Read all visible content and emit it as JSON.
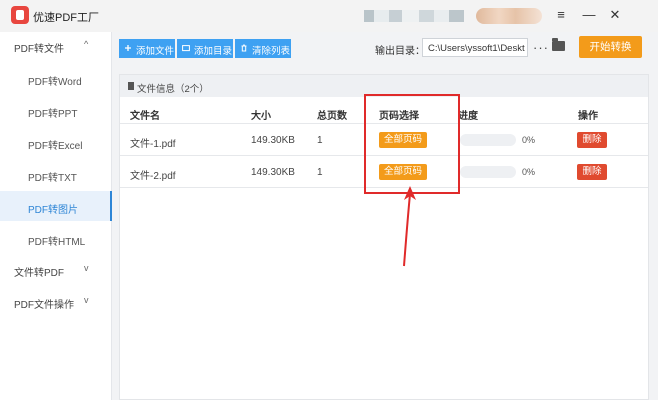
{
  "app": {
    "title": "优速PDF工厂"
  },
  "window_controls": {
    "menu": "≡",
    "minimize": "—",
    "close": "✕"
  },
  "sidebar": {
    "groups": [
      {
        "label": "PDF转文件",
        "chevron": "^"
      },
      {
        "label": "文件转PDF",
        "chevron": "v"
      },
      {
        "label": "PDF文件操作",
        "chevron": "v"
      }
    ],
    "items": [
      {
        "label": "PDF转Word"
      },
      {
        "label": "PDF转PPT"
      },
      {
        "label": "PDF转Excel"
      },
      {
        "label": "PDF转TXT"
      },
      {
        "label": "PDF转图片",
        "active": true
      },
      {
        "label": "PDF转HTML"
      }
    ]
  },
  "toolbar": {
    "add_file": "添加文件",
    "add_dir": "添加目录",
    "clear_list": "清除列表",
    "output_label": "输出目录：",
    "output_path": "C:\\Users\\yssoft1\\Deskt",
    "more": "···",
    "start": "开始转换"
  },
  "panel": {
    "header": "文件信息（2个）"
  },
  "table": {
    "columns": [
      "文件名",
      "大小",
      "总页数",
      "页码选择",
      "进度",
      "操作"
    ],
    "rows": [
      {
        "name": "文件-1.pdf",
        "size": "149.30KB",
        "pages": "1",
        "page_select": "全部页码",
        "progress": 0,
        "progress_text": "0%",
        "action": "删除"
      },
      {
        "name": "文件-2.pdf",
        "size": "149.30KB",
        "pages": "1",
        "page_select": "全部页码",
        "progress": 0,
        "progress_text": "0%",
        "action": "删除"
      }
    ]
  },
  "colors": {
    "accent_blue": "#3ea1f2",
    "orange": "#f39b1a",
    "delete_red": "#e04a2f",
    "annotation_red": "#e02a2a"
  }
}
